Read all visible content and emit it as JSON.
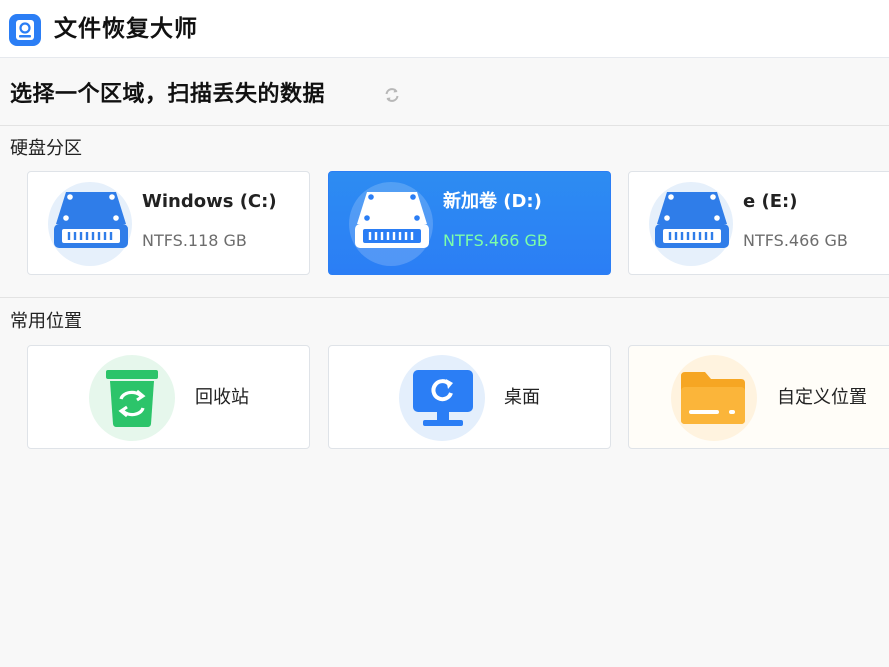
{
  "app": {
    "title": "文件恢复大师",
    "logo_icon": "app-logo-icon"
  },
  "page": {
    "title": "选择一个区域，扫描丢失的数据",
    "refresh_icon": "refresh-icon"
  },
  "partitions": {
    "label": "硬盘分区",
    "items": [
      {
        "name": "Windows (C:)",
        "info": "NTFS.118 GB",
        "selected": false,
        "icon": "hard-drive-icon"
      },
      {
        "name": "新加卷 (D:)",
        "info": "NTFS.466 GB",
        "selected": true,
        "icon": "hard-drive-icon"
      },
      {
        "name": "e (E:)",
        "info": "NTFS.466 GB",
        "selected": false,
        "icon": "hard-drive-icon"
      }
    ]
  },
  "locations": {
    "label": "常用位置",
    "items": [
      {
        "label": "回收站",
        "icon": "recycle-bin-icon"
      },
      {
        "label": "桌面",
        "icon": "desktop-icon"
      },
      {
        "label": "自定义位置",
        "icon": "folder-icon"
      }
    ]
  },
  "colors": {
    "accent": "#2b7ef5",
    "drive_blue": "#2f7de9",
    "recycle_green": "#2cc46a",
    "folder_orange": "#f6a623",
    "selected_info": "#7dffa8"
  }
}
